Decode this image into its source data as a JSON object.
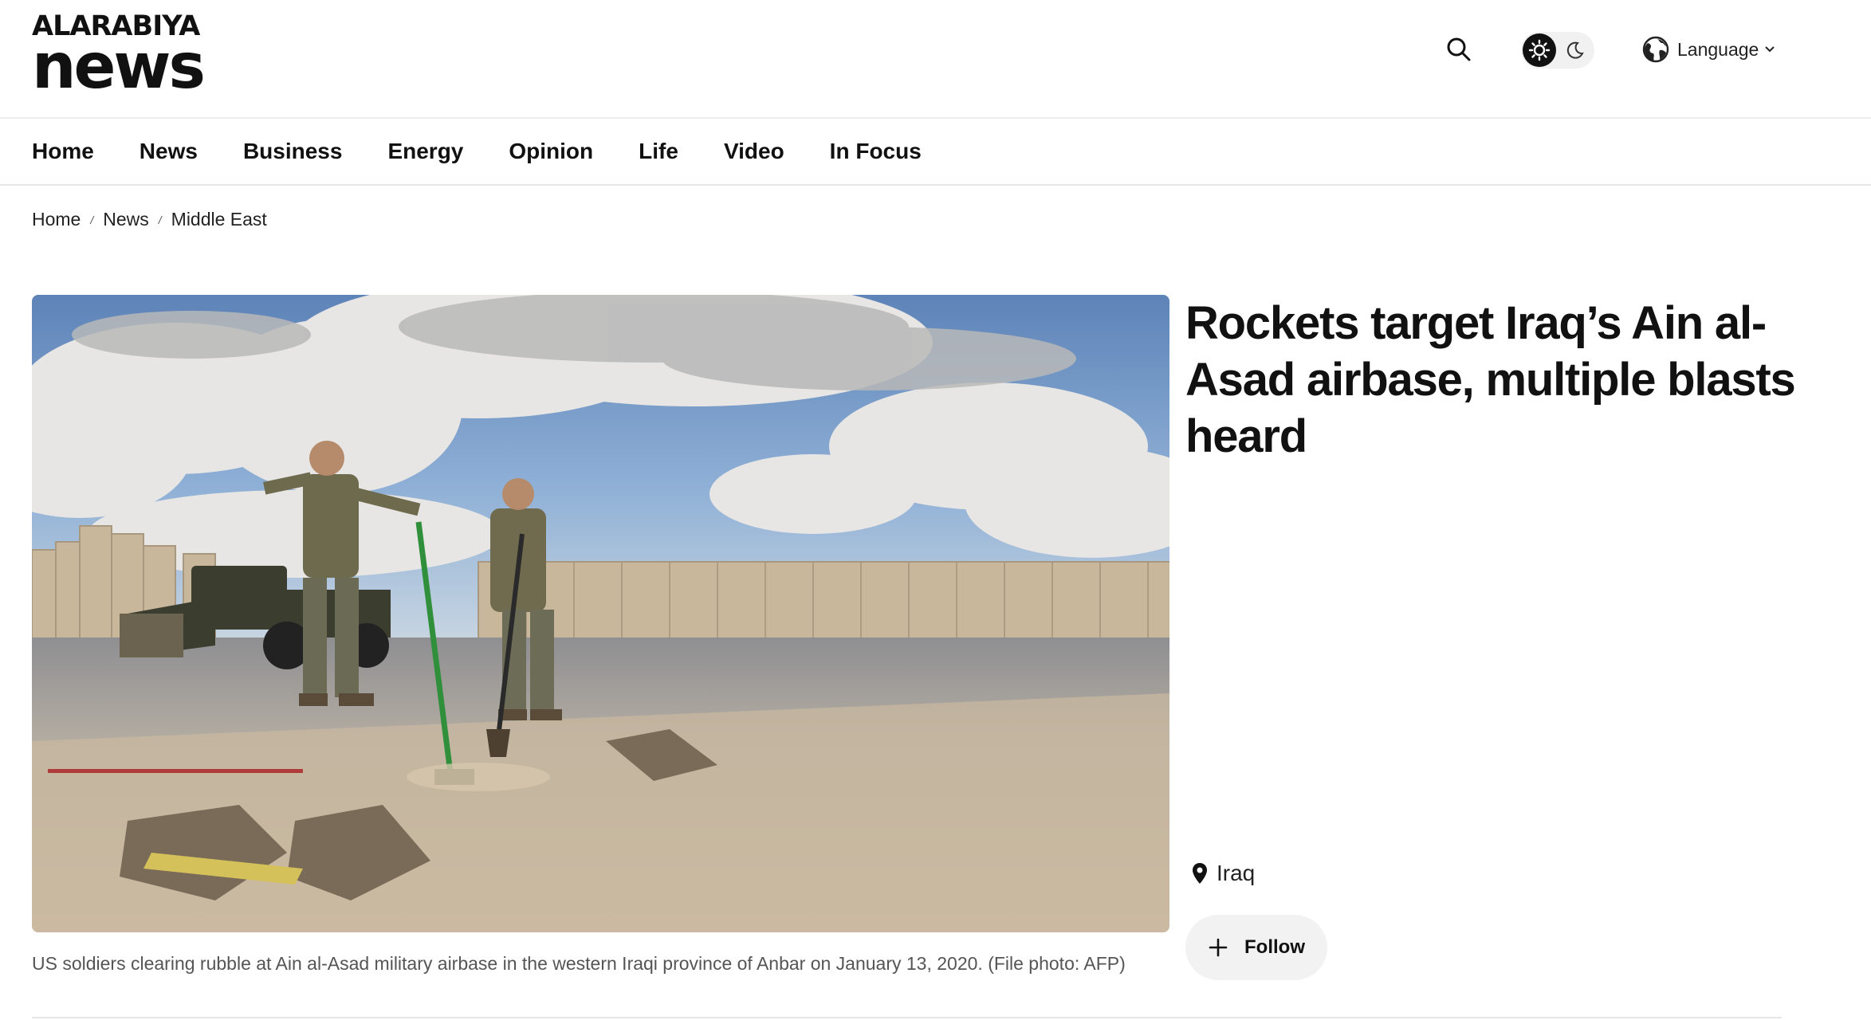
{
  "brand": {
    "logo_top": "ALARABIYA",
    "logo_bottom": "news"
  },
  "header": {
    "search_icon": "search-icon",
    "theme_icons": [
      "sun-icon",
      "moon-icon"
    ],
    "language_label": "Language"
  },
  "nav": {
    "items": [
      {
        "label": "Home"
      },
      {
        "label": "News"
      },
      {
        "label": "Business"
      },
      {
        "label": "Energy"
      },
      {
        "label": "Opinion"
      },
      {
        "label": "Life"
      },
      {
        "label": "Video"
      },
      {
        "label": "In Focus"
      }
    ]
  },
  "breadcrumb": {
    "items": [
      "Home",
      "News",
      "Middle East"
    ],
    "separator": "/"
  },
  "article": {
    "headline": "Rockets target Iraq’s Ain al-Asad airbase, multiple blasts heard",
    "caption": "US soldiers clearing rubble at Ain al-Asad military airbase in the western Iraqi province of Anbar on January 13, 2020. (File photo: AFP)",
    "tag": "Iraq",
    "follow_label": "Follow"
  },
  "colors": {
    "text": "#111111",
    "muted": "#555555",
    "divider": "#e6e6e6",
    "pill_bg": "#f2f2f2",
    "sky": "#6f95c4",
    "sand": "#c8b79f"
  }
}
